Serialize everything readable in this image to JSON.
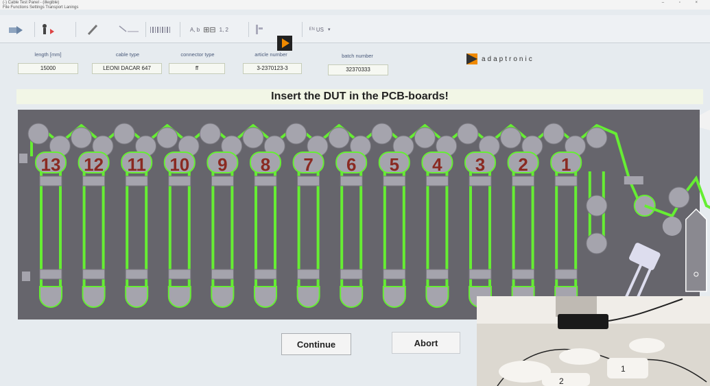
{
  "window": {
    "title": "(-) Cable Test Panel - (illegible)",
    "menu": "File   Functions   Settings   Transport Lanings"
  },
  "toolbar": {
    "text_labels": "A, b",
    "numbers_label": "1, 2",
    "language": "US"
  },
  "fields": [
    {
      "label": "length [mm]",
      "value": "15000"
    },
    {
      "label": "cable type",
      "value": "LEONI DACAR 647"
    },
    {
      "label": "connector type",
      "value": "ff"
    },
    {
      "label": "article number",
      "value": "3-2370123-3"
    },
    {
      "label": "batch number",
      "value": "32370333"
    }
  ],
  "logo": {
    "text": "adaptronic"
  },
  "message": "Insert the DUT in the PCB-boards!",
  "board": {
    "slot_numbers": [
      "13",
      "12",
      "11",
      "10",
      "9",
      "8",
      "7",
      "6",
      "5",
      "4",
      "3",
      "2",
      "1"
    ],
    "colors": {
      "board": "#66656c",
      "cable": "#66ee33",
      "label": "#8a2a22"
    }
  },
  "buttons": {
    "continue": "Continue",
    "abort": "Abort"
  },
  "photo": {
    "labels": [
      "2",
      "1"
    ]
  }
}
